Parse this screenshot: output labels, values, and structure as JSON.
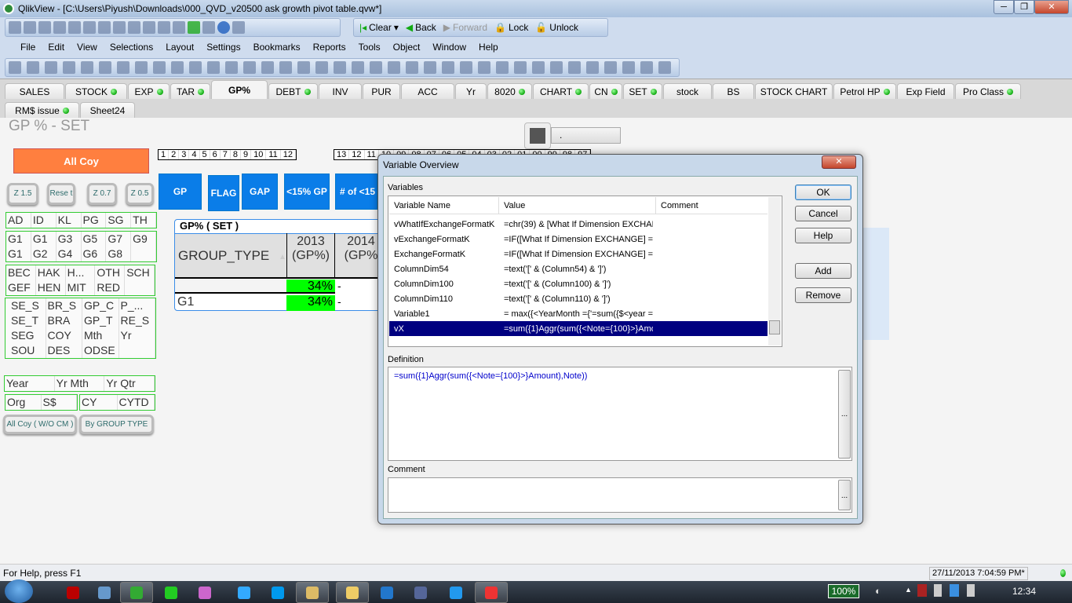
{
  "window": {
    "title": "QlikView - [C:\\Users\\Piyush\\Downloads\\000_QVD_v20500 ask growth pivot table.qvw*]",
    "min": "─",
    "restore": "❐",
    "close": "✕"
  },
  "toolbar_nav": {
    "clear": "Clear",
    "back": "Back",
    "forward": "Forward",
    "lock": "Lock",
    "unlock": "Unlock"
  },
  "menu": [
    "File",
    "Edit",
    "View",
    "Selections",
    "Layout",
    "Settings",
    "Bookmarks",
    "Reports",
    "Tools",
    "Object",
    "Window",
    "Help"
  ],
  "tabs_row1": [
    {
      "label": "SALES",
      "dot": false
    },
    {
      "label": "STOCK",
      "dot": true
    },
    {
      "label": "EXP",
      "dot": true
    },
    {
      "label": "TAR",
      "dot": true
    },
    {
      "label": "GP%",
      "dot": false,
      "active": true
    },
    {
      "label": "DEBT",
      "dot": true
    },
    {
      "label": "INV",
      "dot": false
    },
    {
      "label": "PUR",
      "dot": false
    },
    {
      "label": "ACC",
      "dot": false
    },
    {
      "label": "Yr",
      "dot": false
    },
    {
      "label": "8020",
      "dot": true
    },
    {
      "label": "CHART",
      "dot": true
    },
    {
      "label": "CN",
      "dot": true
    },
    {
      "label": "SET",
      "dot": true
    },
    {
      "label": "stock",
      "dot": false
    },
    {
      "label": "BS",
      "dot": false
    },
    {
      "label": "STOCK CHART",
      "dot": false
    },
    {
      "label": "Petrol HP",
      "dot": true
    },
    {
      "label": "Exp Field",
      "dot": false
    },
    {
      "label": "Pro Class",
      "dot": true
    }
  ],
  "tabs_row2": [
    {
      "label": "RM$ issue",
      "dot": true
    },
    {
      "label": "Sheet24",
      "dot": false
    }
  ],
  "sheet": {
    "title": "GP % - SET",
    "all_coy": "All Coy",
    "months": [
      "1",
      "2",
      "3",
      "4",
      "5",
      "6",
      "7",
      "8",
      "9",
      "10",
      "11",
      "12"
    ],
    "years": [
      "13",
      "12",
      "11",
      "10",
      "09",
      "08",
      "07",
      "06",
      "05",
      "04",
      "03",
      "02",
      "01",
      "00",
      "99",
      "98",
      "97"
    ],
    "blue_buttons": [
      "GP",
      "FLAG",
      "GAP",
      "<15% GP",
      "# of <15"
    ],
    "zoom_buttons": [
      "Z 1.5",
      "Rese t",
      "Z 0.7",
      "Z 0.5"
    ],
    "lb_region": [
      "AD",
      "ID",
      "KL",
      "PG",
      "SG",
      "TH"
    ],
    "lb_groups": [
      "G1",
      "G1",
      "G3",
      "G5",
      "G7",
      "G9",
      "G1",
      "G2",
      "G4",
      "G6",
      "G8",
      ""
    ],
    "lb_codes": [
      "BEC",
      "HAK",
      "H...",
      "OTH",
      "SCH",
      "GEF",
      "HEN",
      "MIT",
      "RED",
      ""
    ],
    "lb_fields": [
      "SE_S",
      "BR_S",
      "GP_C",
      "P_...",
      "SE_T",
      "BRA",
      "GP_T",
      "RE_S",
      "SEG",
      "COY",
      "Mth",
      "Yr",
      "SOU",
      "DES",
      "ODSE",
      ""
    ],
    "lb_period": [
      "Year",
      "Yr Mth",
      "Yr Qtr"
    ],
    "lb_currency": [
      "Org",
      "S$"
    ],
    "lb_cy": [
      "CY",
      "CYTD"
    ],
    "btn_all_coy_wo": "All Coy ( W/O CM )",
    "btn_by_group": "By GROUP TYPE",
    "slider_value": "."
  },
  "pivot": {
    "caption": "GP% ( SET )",
    "dim_header": "GROUP_TYPE",
    "col_headers": [
      "2013 (GP%)",
      "2014 (GP%"
    ],
    "rows": [
      {
        "label": "",
        "v2013": "34%",
        "v2014": "-"
      },
      {
        "label": "G1",
        "v2013": "34%",
        "v2014": "-"
      }
    ],
    "highlight": "#00ff00"
  },
  "dialog": {
    "title": "Variable Overview",
    "variables_label": "Variables",
    "columns": [
      "Variable Name",
      "Value",
      "Comment"
    ],
    "rows": [
      {
        "name": "vWhatIfExchangeFormatK",
        "value": "=chr(39) & [What If Dimension EXCHAN(",
        "comment": ""
      },
      {
        "name": "vExchangeFormatK",
        "value": "=IF([What If Dimension EXCHANGE] = '(",
        "comment": ""
      },
      {
        "name": "ExchangeFormatK",
        "value": "=IF([What If Dimension EXCHANGE] = '(",
        "comment": ""
      },
      {
        "name": "ColumnDim54",
        "value": "=text('[' & (Column54) & ']')",
        "comment": ""
      },
      {
        "name": "ColumnDim100",
        "value": "=text('[' & (Column100) & ']')",
        "comment": ""
      },
      {
        "name": "ColumnDim110",
        "value": "=text('[' & (Column110) & ']')",
        "comment": ""
      },
      {
        "name": "Variable1",
        "value": "= max({<YearMonth ={'=sum({$<year = {:",
        "comment": ""
      },
      {
        "name": "vX",
        "value": "=sum({1}Aggr(sum({<Note={100}>}Amou",
        "comment": "",
        "selected": true
      }
    ],
    "definition_label": "Definition",
    "definition": "=sum({1}Aggr(sum({<Note={100}>}Amount),Note))",
    "comment_label": "Comment",
    "comment": "",
    "buttons": {
      "ok": "OK",
      "cancel": "Cancel",
      "help": "Help",
      "add": "Add",
      "remove": "Remove",
      "ellipsis": "..."
    }
  },
  "status": {
    "help": "For Help, press F1",
    "datetime": "27/11/2013 7:04:59 PM*"
  },
  "taskbar": {
    "battery": "100%",
    "clock": "12:34"
  }
}
